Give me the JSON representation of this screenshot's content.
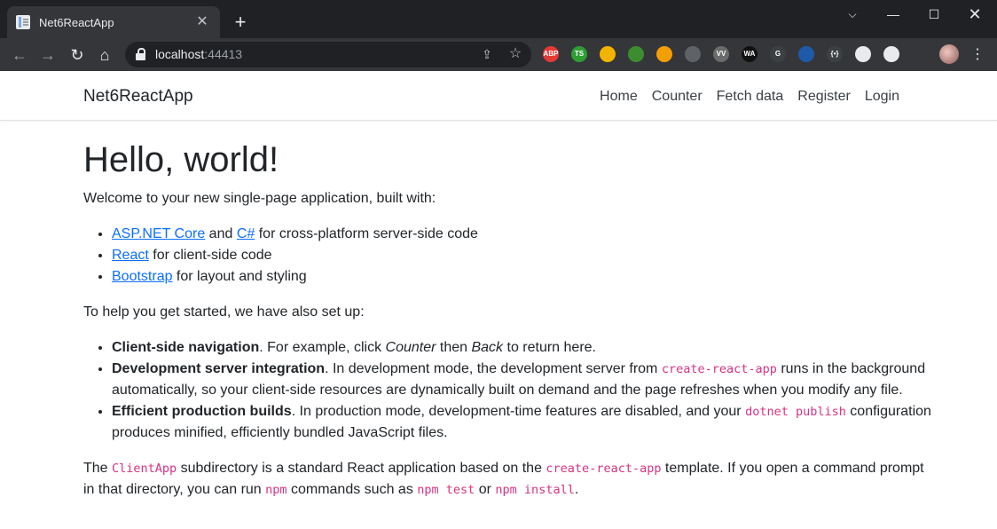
{
  "browser": {
    "tab_title": "Net6ReactApp",
    "url_host": "localhost",
    "url_port": ":44413",
    "extensions": [
      {
        "name": "adblock-plus-extension",
        "label": "ABP",
        "color": "#e53935"
      },
      {
        "name": "ts-extension",
        "label": "TS",
        "color": "#2e9d34"
      },
      {
        "name": "google-drive-extension",
        "label": "",
        "color": "#f2b400"
      },
      {
        "name": "screenshot-extension",
        "label": "",
        "color": "#3c8d2f"
      },
      {
        "name": "color-picker-extension",
        "label": "",
        "color": "#f29f05"
      },
      {
        "name": "pen-extension",
        "label": "",
        "color": "#5f6368"
      },
      {
        "name": "vv-extension",
        "label": "VV",
        "color": "#6b6b6b"
      },
      {
        "name": "wa-extension",
        "label": "WA",
        "color": "#111111"
      },
      {
        "name": "grammarly-extension",
        "label": "G",
        "color": "#3c4043"
      },
      {
        "name": "triangle-extension",
        "label": "",
        "color": "#1e5aa8"
      },
      {
        "name": "json-extension",
        "label": "{•}",
        "color": "#3c4043"
      },
      {
        "name": "globe-extension",
        "label": "",
        "color": "#e8eaed"
      },
      {
        "name": "puzzle-extension",
        "label": "",
        "color": "#e8eaed"
      }
    ]
  },
  "navbar": {
    "brand": "Net6ReactApp",
    "links": [
      "Home",
      "Counter",
      "Fetch data",
      "Register",
      "Login"
    ]
  },
  "page": {
    "heading": "Hello, world!",
    "intro": "Welcome to your new single-page application, built with:",
    "built_with": {
      "aspnet_link": "ASP.NET Core",
      "and": " and ",
      "csharp_link": "C#",
      "server_text": " for cross-platform server-side code",
      "react_link": "React",
      "client_text": " for client-side code",
      "bootstrap_link": "Bootstrap",
      "bootstrap_text": " for layout and styling"
    },
    "setup_intro": "To help you get started, we have also set up:",
    "features": {
      "nav_title": "Client-side navigation",
      "nav_a": ". For example, click ",
      "nav_counter": "Counter",
      "nav_b": " then ",
      "nav_back": "Back",
      "nav_c": " to return here.",
      "dev_title": "Development server integration",
      "dev_a": ". In development mode, the development server from ",
      "dev_code": "create-react-app",
      "dev_b": " runs in the background automatically, so your client-side resources are dynamically built on demand and the page refreshes when you modify any file.",
      "prod_title": "Efficient production builds",
      "prod_a": ". In production mode, development-time features are disabled, and your ",
      "prod_code": "dotnet publish",
      "prod_b": " configuration produces minified, efficiently bundled JavaScript files."
    },
    "footer": {
      "a": "The ",
      "clientapp": "ClientApp",
      "b": " subdirectory is a standard React application based on the ",
      "cra": "create-react-app",
      "c": " template. If you open a command prompt in that directory, you can run ",
      "npm": "npm",
      "d": " commands such as ",
      "npm_test": "npm test",
      "e": " or ",
      "npm_install": "npm install",
      "f": "."
    }
  }
}
